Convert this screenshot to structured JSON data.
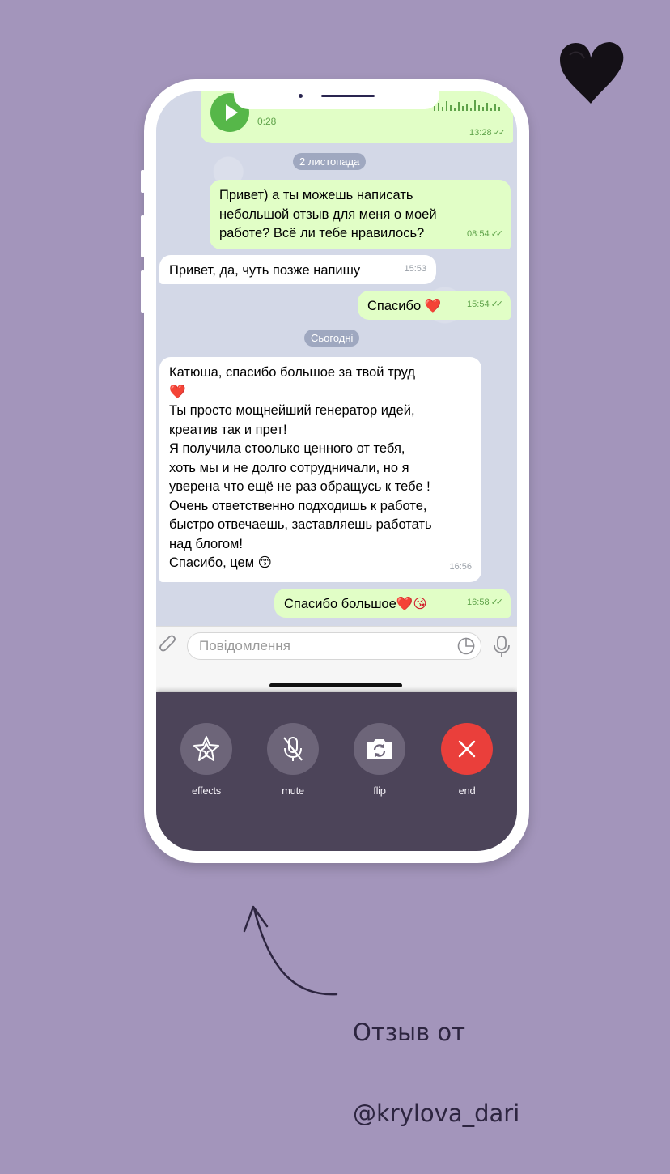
{
  "colors": {
    "background": "#a395bb",
    "outgoing_bubble": "#e1fec6",
    "incoming_bubble": "#ffffff",
    "call_panel": "#4c4459",
    "end_call": "#ea3f3b",
    "accent_green": "#56b749"
  },
  "voice_message": {
    "duration": "0:28",
    "time": "13:28"
  },
  "chat": {
    "date_1": "2 листопада",
    "msg_1": {
      "text": "Привет) а ты можешь написать\nнебольшой отзыв для меня о моей\nработе? Всё ли тебе нравилось?",
      "time": "08:54"
    },
    "msg_2": {
      "text": "Привет, да, чуть позже напишу",
      "time": "15:53"
    },
    "msg_3": {
      "text": "Спасибо",
      "emoji": "❤️",
      "time": "15:54"
    },
    "date_2": "Сьогодні",
    "msg_4": {
      "line_1": "Катюша, спасибо большое за твой труд",
      "emoji_1": "❤️",
      "body": "Ты просто мощнейший генератор идей,\nкреатив так и прет!\nЯ получила стоолько ценного от тебя,\nхоть мы и не долго сотрудничали, но я\nуверена что ещё не раз обращусь к тебе !\nОчень ответственно подходишь к работе,\nбыстро отвечаешь, заставляешь работать\nнад блогом!",
      "closing": "Спасибо, цем",
      "emoji_2": "😙",
      "time": "16:56"
    },
    "msg_5": {
      "text": "Спасибо большое",
      "emoji": "❤️😘",
      "time": "16:58"
    }
  },
  "composer": {
    "placeholder": "Повідомлення"
  },
  "call_controls": {
    "effects": "effects",
    "mute": "mute",
    "flip": "flip",
    "end": "end"
  },
  "caption": {
    "line_1": "Отзыв от",
    "line_2": "@krylova_dari"
  },
  "icons": [
    "heart-doodle-icon",
    "play-icon",
    "paperclip-icon",
    "sticker-icon",
    "microphone-icon",
    "effects-star-icon",
    "mute-mic-icon",
    "camera-flip-icon",
    "close-icon",
    "arrow-icon"
  ]
}
